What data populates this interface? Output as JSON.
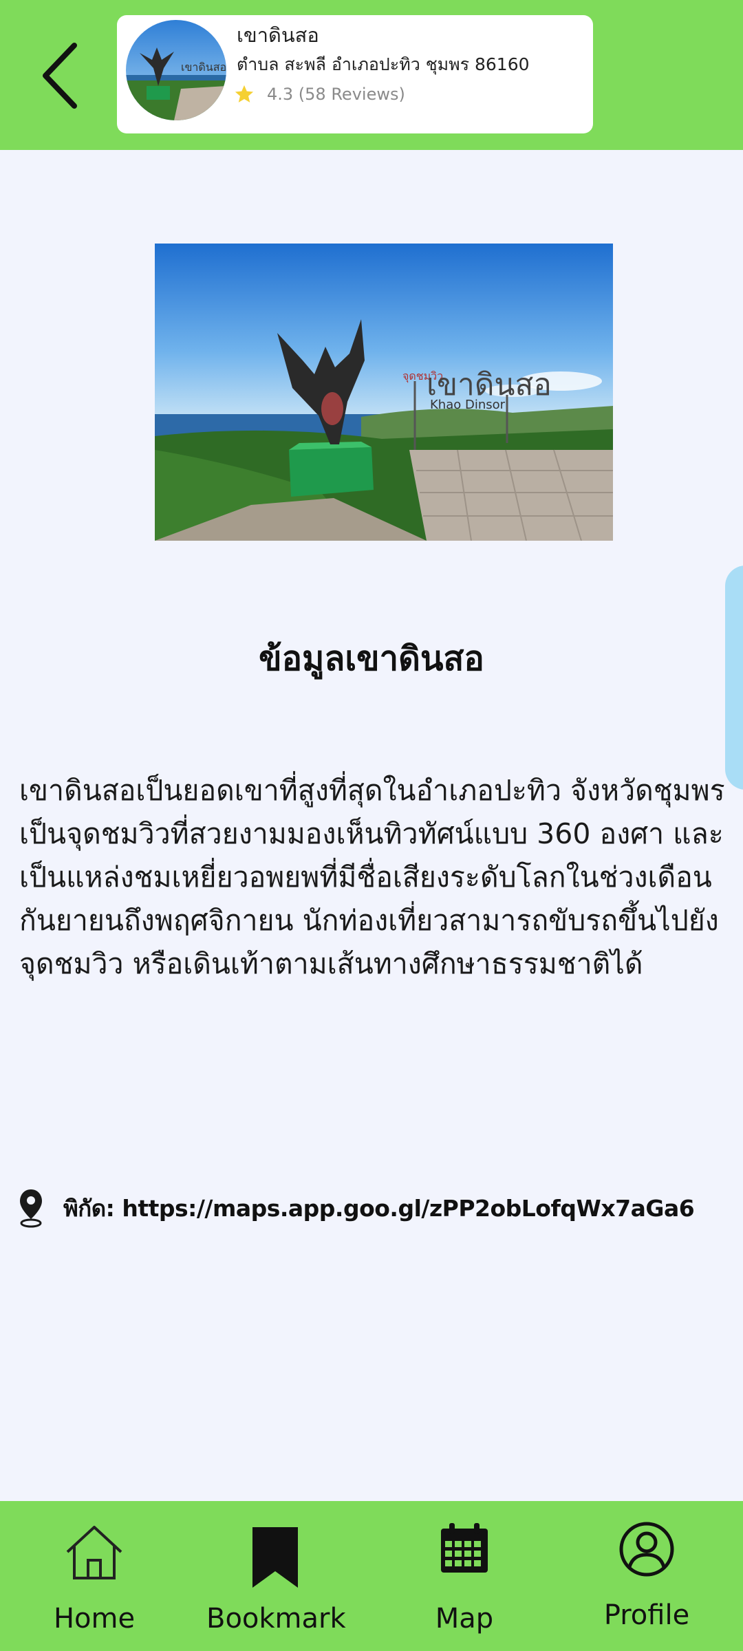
{
  "header": {
    "back_icon": "chevron-left-icon",
    "place": {
      "name": "เขาดินสอ",
      "address": "ตำบล สะพลี อำเภอปะทิว ชุมพร 86160",
      "rating_text": "4.3 (58 Reviews)",
      "star_color": "#f5d033"
    }
  },
  "content": {
    "title": "ข้อมูลเขาดินสอ",
    "description": "เขาดินสอเป็นยอดเขาที่สูงที่สุดในอำเภอปะทิว จังหวัดชุมพร เป็นจุดชมวิวที่สวยงามมองเห็นทิวทัศน์แบบ 360 องศา และเป็นแหล่งชมเหยี่ยวอพยพที่มีชื่อเสียงระดับโลกในช่วงเดือนกันยายนถึงพฤศจิกายน นักท่องเที่ยวสามารถขับรถขึ้นไปยังจุดชมวิว หรือเดินเท้าตามเส้นทางศึกษาธรรมชาติได้",
    "location_label": "พิกัด: https://maps.app.goo.gl/zPP2obLofqWx7aGa6",
    "location_icon": "map-pin-icon",
    "image_sign_thai": "เขาดินสอ",
    "image_sign_prefix": "จุดชมวิว",
    "image_sign_en": "Khao Dinsor"
  },
  "nav": {
    "items": [
      {
        "label": "Home",
        "icon": "home-icon"
      },
      {
        "label": "Bookmark",
        "icon": "bookmark-icon"
      },
      {
        "label": "Map",
        "icon": "calendar-icon"
      },
      {
        "label": "Profile",
        "icon": "user-icon"
      }
    ]
  },
  "colors": {
    "header_bg": "#7fdb5a",
    "page_bg": "#f2f4fd",
    "side_tab": "#a9ddf6"
  }
}
